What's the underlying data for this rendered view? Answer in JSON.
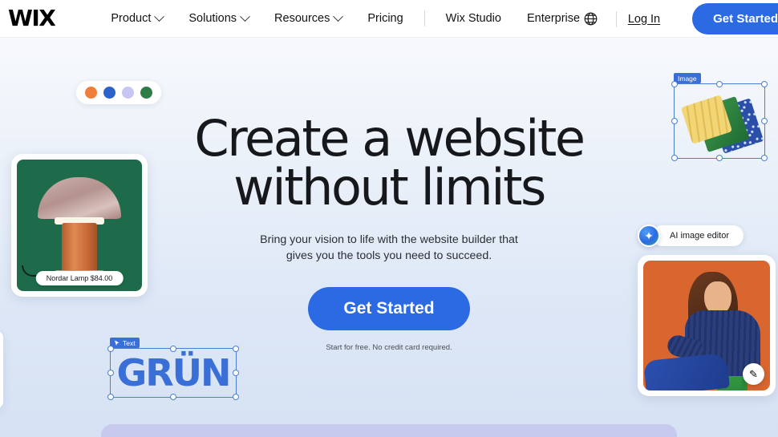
{
  "nav": {
    "logo": "WIX",
    "items": [
      {
        "label": "Product",
        "has_dropdown": true
      },
      {
        "label": "Solutions",
        "has_dropdown": true
      },
      {
        "label": "Resources",
        "has_dropdown": true
      },
      {
        "label": "Pricing",
        "has_dropdown": false
      },
      {
        "label": "Wix Studio",
        "has_dropdown": false
      },
      {
        "label": "Enterprise",
        "has_dropdown": false
      }
    ],
    "language_icon": "globe-icon",
    "login_label": "Log In",
    "get_started_label": "Get Started"
  },
  "hero": {
    "headline_line1": "Create a website",
    "headline_line2": "without limits",
    "subtitle_line1": "Bring your vision to life with the website builder that",
    "subtitle_line2": "gives you the tools you need to succeed.",
    "cta_label": "Get Started",
    "fineprint": "Start for free. No credit card required."
  },
  "palette": {
    "name": "color-palette",
    "colors": [
      "#ef7e3c",
      "#2b63c9",
      "#c5c6f2",
      "#2e7d47"
    ]
  },
  "lamp_card": {
    "product_label": "Nordar Lamp $84.00",
    "background_color": "#1d6b4a"
  },
  "image_selection": {
    "badge_label": "Image",
    "handle_color": "#4a7fd4"
  },
  "ai_editor": {
    "icon": "sparkle-icon",
    "icon_glyph": "✦",
    "label": "AI image editor"
  },
  "photo_card": {
    "edit_button_icon": "pencil-sparkle-icon",
    "edit_button_glyph": "✎",
    "background_color": "#d9662f"
  },
  "text_selection": {
    "badge_icon": "cursor-pin-icon",
    "badge_label": "Text",
    "text_value": "GRÜN",
    "text_color": "#3a6fd8"
  },
  "theme": {
    "accent_blue": "#2b6ae3",
    "selection_blue": "#4a7fd4",
    "bottom_panel": "#c7c9ef"
  }
}
